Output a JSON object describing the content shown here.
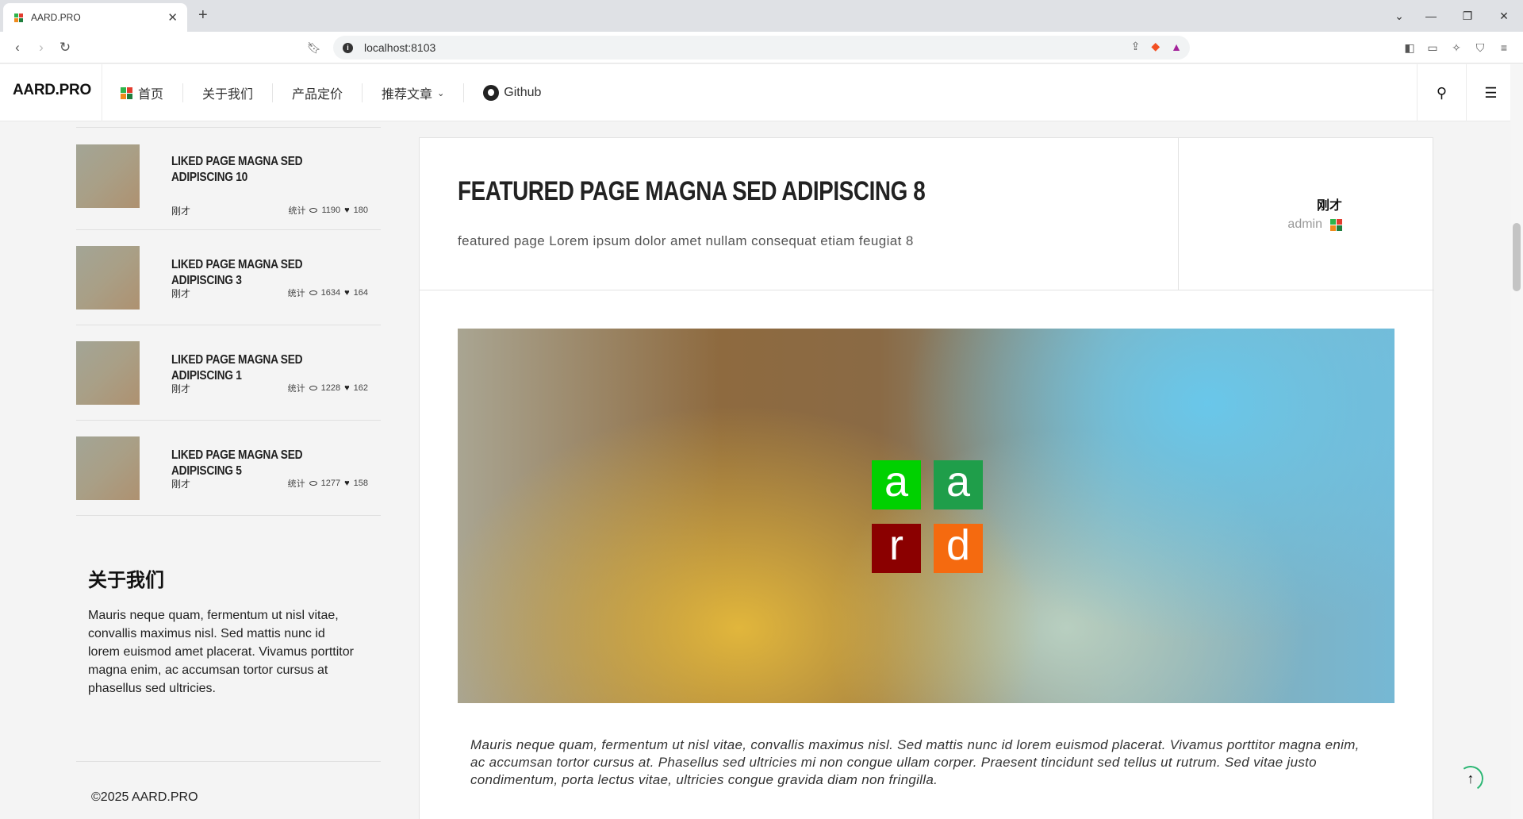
{
  "browser": {
    "tab_title": "AARD.PRO",
    "url": "localhost:8103"
  },
  "header": {
    "logo": "AARD.PRO",
    "menu": [
      {
        "label": "首页"
      },
      {
        "label": "关于我们"
      },
      {
        "label": "产品定价"
      },
      {
        "label": "推荐文章"
      },
      {
        "label": "Github"
      }
    ]
  },
  "sidebar": {
    "posts": [
      {
        "title": "LIKED PAGE MAGNA SED ADIPISCING 10",
        "date": "刚才",
        "stats_label": "统计",
        "views": "1190",
        "likes": "180"
      },
      {
        "title": "LIKED PAGE MAGNA SED ADIPISCING 3",
        "date": "刚才",
        "stats_label": "统计",
        "views": "1634",
        "likes": "164"
      },
      {
        "title": "LIKED PAGE MAGNA SED ADIPISCING 1",
        "date": "刚才",
        "stats_label": "统计",
        "views": "1228",
        "likes": "162"
      },
      {
        "title": "LIKED PAGE MAGNA SED ADIPISCING 5",
        "date": "刚才",
        "stats_label": "统计",
        "views": "1277",
        "likes": "158"
      }
    ],
    "about_heading": "关于我们",
    "about_text": " Mauris neque quam, fermentum ut nisl vitae, convallis maximus nisl. Sed mattis nunc id lorem euismod amet placerat. Vivamus porttitor magna enim, ac accumsan tortor cursus at phasellus sed ultricies.",
    "copyright": "©2025 AARD.PRO"
  },
  "article": {
    "title": "FEATURED PAGE MAGNA SED ADIPISCING 8",
    "subtitle": "featured page Lorem ipsum dolor amet nullam consequat etiam feugiat 8",
    "date": "刚才",
    "author": "admin",
    "logo_letters": [
      "a",
      "a",
      "r",
      "d"
    ],
    "logo_colors": [
      "#00d100",
      "#1f9e4a",
      "#8b0000",
      "#f56a0f"
    ],
    "body": "Mauris neque quam, fermentum ut nisl vitae, convallis maximus nisl. Sed mattis nunc id lorem euismod placerat. Vivamus porttitor magna enim, ac accumsan tortor cursus at. Phasellus sed ultricies mi non congue ullam corper. Praesent tincidunt sed tellus ut rutrum. Sed vitae justo condimentum, porta lectus vitae, ultricies congue gravida diam non fringilla."
  },
  "icons": {
    "favicon_colors": [
      "#2eb44a",
      "#e33c2e",
      "#f08a1c",
      "#1f7f3e"
    ]
  }
}
